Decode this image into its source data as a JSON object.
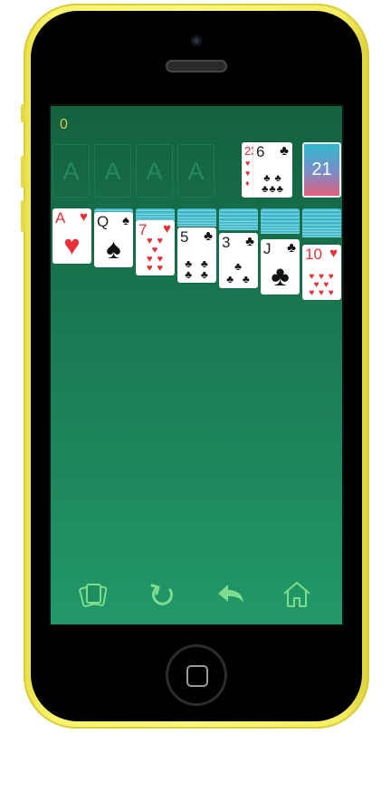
{
  "game": {
    "score": "0",
    "foundations": [
      "A",
      "A",
      "A",
      "A"
    ],
    "stock_count": "21",
    "waste": {
      "under_rank": "2",
      "under_rank2": "3",
      "top_rank": "6",
      "top_suit": "clubs"
    },
    "tableau": [
      {
        "rank": "A",
        "suit": "hearts",
        "pip": "♥",
        "hidden_cards": 0
      },
      {
        "rank": "Q",
        "suit": "spades",
        "pip": "♠",
        "hidden_cards": 1
      },
      {
        "rank": "7",
        "suit": "hearts",
        "pip": "♥",
        "hidden_cards": 2
      },
      {
        "rank": "5",
        "suit": "clubs",
        "pip": "♣",
        "hidden_cards": 3
      },
      {
        "rank": "3",
        "suit": "clubs",
        "pip": "♣",
        "hidden_cards": 4
      },
      {
        "rank": "J",
        "suit": "clubs",
        "pip": "♣",
        "hidden_cards": 5
      },
      {
        "rank": "10",
        "suit": "hearts",
        "pip": "♥",
        "hidden_cards": 6
      }
    ]
  },
  "toolbar": {
    "icons": [
      "cards-icon",
      "restart-icon",
      "undo-icon",
      "home-icon"
    ],
    "color": "#7ddc8e"
  },
  "colors": {
    "phone": "#fdf57a",
    "felt_top": "#13613f",
    "felt_bottom": "#229868",
    "score": "#d5c851",
    "red_suit": "#e8303b"
  }
}
